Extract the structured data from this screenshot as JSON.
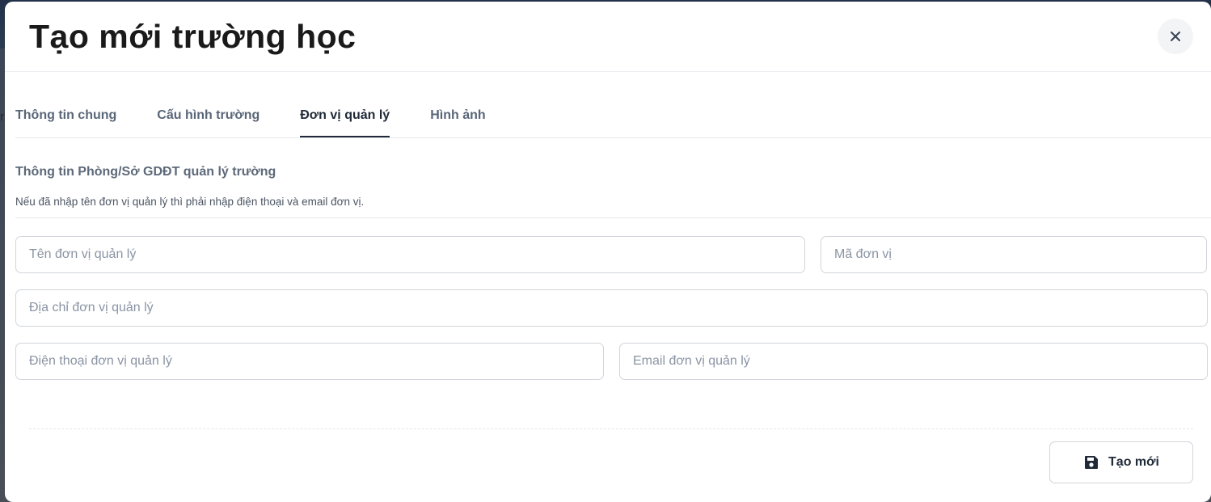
{
  "background": {
    "peek_text": "r"
  },
  "modal": {
    "title": "Tạo mới trường học",
    "close_icon": "close-icon"
  },
  "tabs": [
    {
      "label": "Thông tin chung",
      "active": false
    },
    {
      "label": "Cấu hình trường",
      "active": false
    },
    {
      "label": "Đơn vị quản lý",
      "active": true
    },
    {
      "label": "Hình ảnh",
      "active": false
    }
  ],
  "section": {
    "title": "Thông tin Phòng/Sở GDĐT quản lý trường",
    "description": "Nếu đã nhập tên đơn vị quản lý thì phải nhập điện thoại và email đơn vị."
  },
  "fields": {
    "unit_name": {
      "value": "",
      "placeholder": "Tên đơn vị quản lý"
    },
    "unit_code": {
      "value": "",
      "placeholder": "Mã đơn vị"
    },
    "unit_address": {
      "value": "",
      "placeholder": "Địa chỉ đơn vị quản lý"
    },
    "unit_phone": {
      "value": "",
      "placeholder": "Điện thoại đơn vị quản lý"
    },
    "unit_email": {
      "value": "",
      "placeholder": "Email đơn vị quản lý"
    }
  },
  "footer": {
    "submit_label": "Tạo mới",
    "submit_icon": "save-icon"
  },
  "colors": {
    "title": "#1a1a1a",
    "tab_inactive": "#596678",
    "tab_active": "#1f2937",
    "border": "#d1d5db",
    "placeholder": "#8a94a3"
  }
}
